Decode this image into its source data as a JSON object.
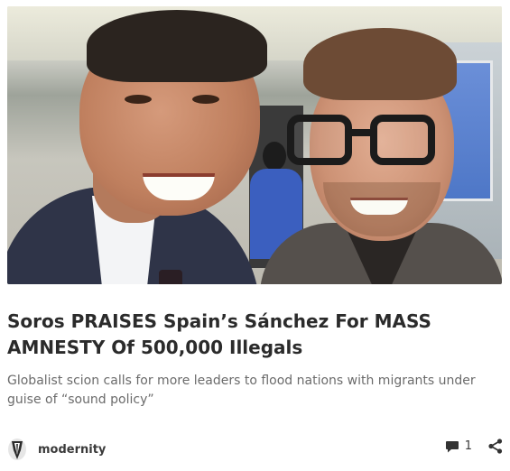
{
  "post": {
    "title": "Soros PRAISES Spain’s Sánchez For MASS AMNESTY Of 500,000 Illegals",
    "subtitle": "Globalist scion calls for more leaders to flood nations with migrants under guise of “sound policy”",
    "author": "modernity",
    "comment_count": "1",
    "icons": {
      "avatar": "author-avatar-icon",
      "comment": "comment-bubble-icon",
      "share": "share-icon"
    }
  }
}
